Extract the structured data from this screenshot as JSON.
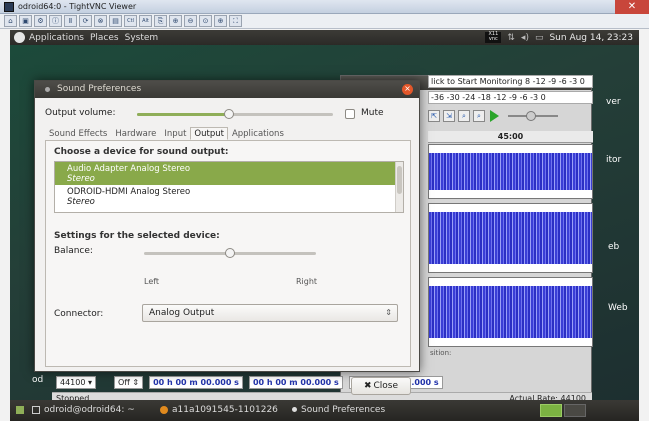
{
  "host_window": {
    "title": "odroid64:0 - TightVNC Viewer",
    "close_glyph": "✕"
  },
  "vnc_toolbar": {
    "buttons": [
      "new-connection-icon",
      "save-icon",
      "options-icon",
      "info-icon",
      "pause-icon",
      "refresh-icon",
      "ctrl-alt-del-icon",
      "ctrl-esc-icon",
      "ctrl-key-icon",
      "alt-key-icon",
      "clipboard-icon",
      "zoom-in-icon",
      "zoom-out-icon",
      "zoom-100-icon",
      "zoom-fit-icon",
      "fullscreen-icon"
    ],
    "labels": [
      "⌂",
      "▣",
      "⚙",
      "ⓘ",
      "Ⅱ",
      "⟳",
      "⊗",
      "▤",
      "Ctl",
      "Alt",
      "⎘",
      "⊕",
      "⊖",
      "⊙",
      "⊕",
      "⛶"
    ]
  },
  "top_panel": {
    "menus": [
      "Applications",
      "Places",
      "System"
    ],
    "x11_badge": "X11\nvnc",
    "clock": "Sun Aug 14, 23:23"
  },
  "desktop": {
    "labels": [
      "ver",
      "itor",
      "eb",
      "Web",
      "od"
    ]
  },
  "audacity": {
    "meter_monitor": "lick to Start Monitoring 8   -12 -9 -6 -3 0",
    "meter_playback": "-36  -30  -24  -18   -12 -9 -6 -3 0",
    "tool_glyphs": [
      "⇱",
      "⇲",
      "⌕",
      "⌕"
    ],
    "timeline_label": "45:00",
    "selection_label": "sition:",
    "project_rate": "44100",
    "snap_to": "Off",
    "times": [
      "00 h 00 m 00.000 s",
      "00 h 00 m 00.000 s",
      "00 h 00 m 00.000 s"
    ],
    "status": "Stopped.",
    "actual_rate": "Actual Rate: 44100"
  },
  "dialog": {
    "title": "Sound Preferences",
    "output_volume_label": "Output volume:",
    "volume_level": 0.47,
    "mute_label": "Mute",
    "tabs": [
      "Sound Effects",
      "Hardware",
      "Input",
      "Output",
      "Applications"
    ],
    "active_tab": "Output",
    "choose_label": "Choose a device for sound output:",
    "devices": [
      {
        "name": "Audio Adapter Analog Stereo",
        "sub": "Stereo",
        "selected": true
      },
      {
        "name": "ODROID-HDMI Analog Stereo",
        "sub": "Stereo",
        "selected": false
      }
    ],
    "settings_label": "Settings for the selected device:",
    "balance_label": "Balance:",
    "balance_value": 0.5,
    "left_label": "Left",
    "right_label": "Right",
    "connector_label": "Connector:",
    "connector_value": "Analog Output",
    "close_label": "Close"
  },
  "bottom_panel": {
    "items": [
      "odroid@odroid64: ~",
      "a11a1091545-1101226",
      "Sound Preferences"
    ]
  },
  "colors": {
    "selection": "#89a94a",
    "waveform": "#3a3ed6",
    "close_orange": "#e3572a"
  }
}
